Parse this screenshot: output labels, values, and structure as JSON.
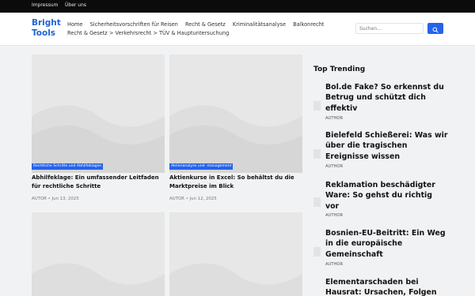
{
  "topbar": {
    "links": [
      "Impressum",
      "Über uns"
    ]
  },
  "header": {
    "logo": "Bright Tools",
    "nav": [
      "Home",
      "Sicherheitsvorschriften für Reisen",
      "Recht & Gesetz",
      "Kriminalitätsanalyse",
      "Balkonrecht",
      "Recht & Gesetz > Verkehrsrecht > TÜV & Hauptuntersuchung"
    ],
    "search_placeholder": "Suchen...",
    "search_icon": "search-icon"
  },
  "cards": [
    {
      "tag": "Rechtliche Schritte und Abhilfeklagen",
      "title": "Abhilfeklage: Ein umfassender Leitfaden für rechtliche Schritte",
      "meta": "AUTOR • Jun 13, 2025"
    },
    {
      "tag": "Aktienanalyse und -management",
      "title": "Aktienkurse in Excel: So behältst du die Marktpreise im Blick",
      "meta": "AUTOR • Jun 12, 2025"
    },
    {
      "tag": "",
      "title": "",
      "meta": ""
    },
    {
      "tag": "",
      "title": "",
      "meta": ""
    }
  ],
  "trending": {
    "heading": "Top Trending",
    "items": [
      {
        "title": "Bol.de Fake? So erkennst du Betrug und schützt dich effektiv",
        "author": "AUTHOR"
      },
      {
        "title": "Bielefeld Schießerei: Was wir über die tragischen Ereignisse wissen",
        "author": "AUTHOR"
      },
      {
        "title": "Reklamation beschädigter Ware: So gehst du richtig vor",
        "author": "AUTHOR"
      },
      {
        "title": "Bosnien-EU-Beitritt: Ein Weg in die europäische Gemeinschaft",
        "author": "AUTHOR"
      },
      {
        "title": "Elementarschaden bei Hausrat: Ursachen, Folgen",
        "author": ""
      }
    ]
  },
  "colors": {
    "accent": "#2563eb",
    "logo": "#1f63d6",
    "topbar": "#0b0b0b",
    "page_bg": "#f1f2f4"
  }
}
